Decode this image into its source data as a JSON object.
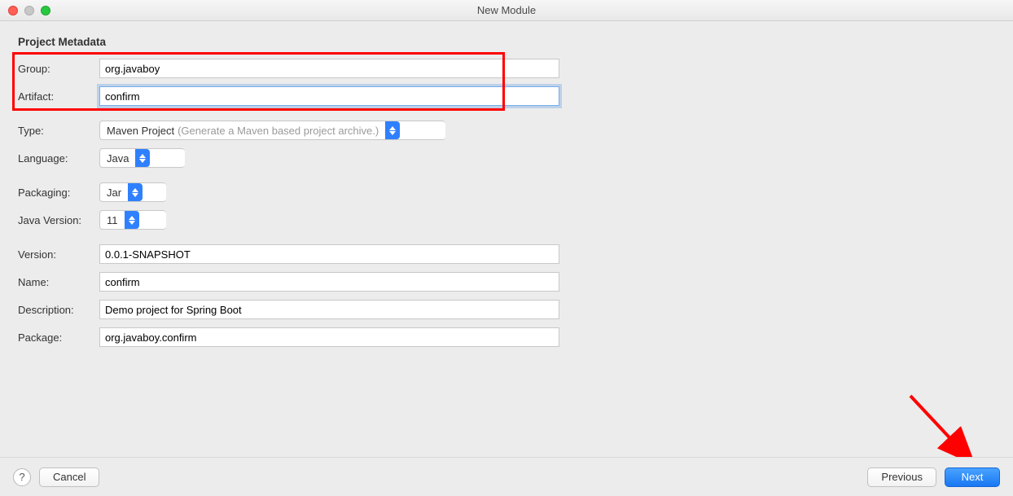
{
  "window": {
    "title": "New Module"
  },
  "section": {
    "title": "Project Metadata"
  },
  "labels": {
    "group": "Group:",
    "artifact": "Artifact:",
    "type": "Type:",
    "language": "Language:",
    "packaging": "Packaging:",
    "javaVersion": "Java Version:",
    "version": "Version:",
    "name": "Name:",
    "description": "Description:",
    "package": "Package:"
  },
  "fields": {
    "group": "org.javaboy",
    "artifact": "confirm",
    "type": {
      "value": "Maven Project",
      "hint": "(Generate a Maven based project archive.)"
    },
    "language": "Java",
    "packaging": "Jar",
    "javaVersion": "11",
    "version": "0.0.1-SNAPSHOT",
    "name": "confirm",
    "description": "Demo project for Spring Boot",
    "package": "org.javaboy.confirm"
  },
  "buttons": {
    "help": "?",
    "cancel": "Cancel",
    "previous": "Previous",
    "next": "Next"
  }
}
